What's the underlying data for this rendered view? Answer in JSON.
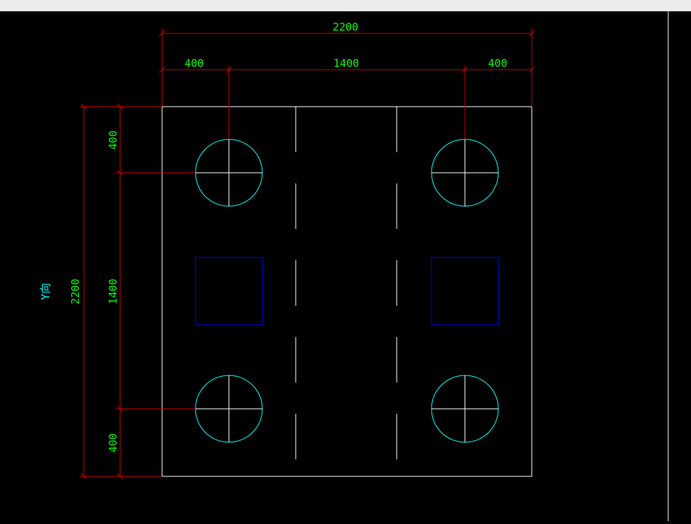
{
  "window": {
    "topbar_label": ""
  },
  "drawing": {
    "colors": {
      "background": "#000000",
      "outline": "#ffffff",
      "dimension_line": "#cc0000",
      "dimension_text": "#00ff00",
      "pile_circle": "#00ffff",
      "column": "#0000ff",
      "axis_label": "#00ffff"
    },
    "dimensions": {
      "top_overall": "2200",
      "top_left": "400",
      "top_middle": "1400",
      "top_right": "400",
      "left_overall": "2200",
      "left_top": "400",
      "left_middle": "1400",
      "left_bottom": "400"
    },
    "axis_label": "Y向"
  }
}
